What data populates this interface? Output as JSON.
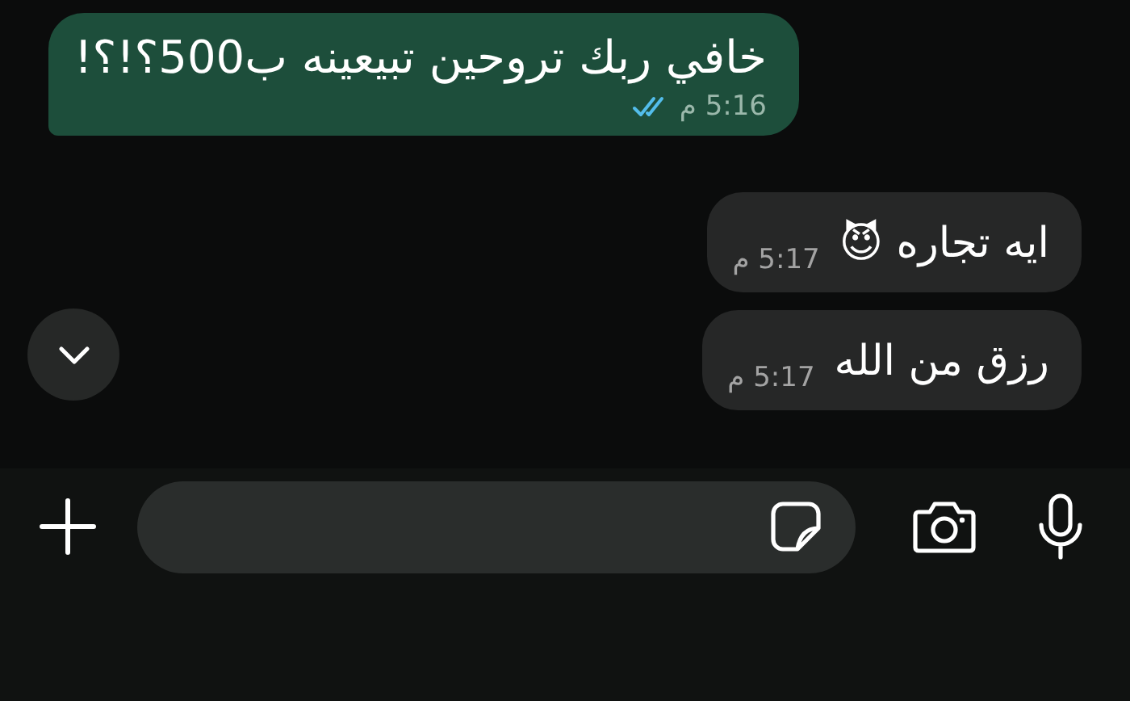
{
  "messages": [
    {
      "kind": "sent",
      "text": "خافي ربك تروحين تبيعينه ب500؟!؟!",
      "time": "5:16 م",
      "read": true
    },
    {
      "kind": "received",
      "text": "ايه تجاره 😈",
      "time": "5:17 م"
    },
    {
      "kind": "received",
      "text": "رزق من الله",
      "time": "5:17 م"
    }
  ]
}
